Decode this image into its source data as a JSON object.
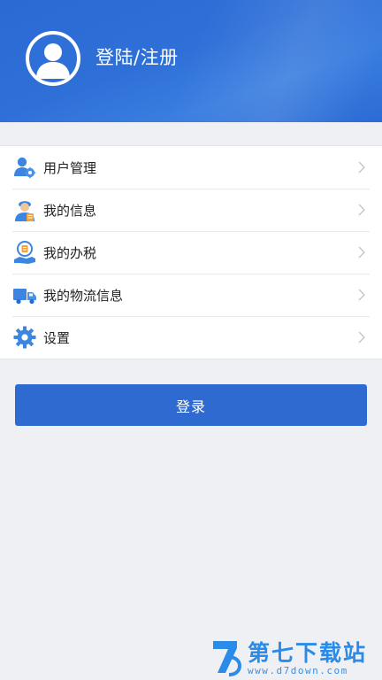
{
  "header": {
    "title": "登陆/注册",
    "avatar_icon": "user-avatar-icon",
    "background_color": "#2f70d8"
  },
  "menu": {
    "items": [
      {
        "label": "用户管理",
        "icon": "user-manage-icon"
      },
      {
        "label": "我的信息",
        "icon": "my-info-icon"
      },
      {
        "label": "我的办税",
        "icon": "tax-handling-icon"
      },
      {
        "label": "我的物流信息",
        "icon": "logistics-truck-icon"
      },
      {
        "label": "设置",
        "icon": "settings-gear-icon"
      }
    ],
    "chevron_icon": "chevron-right-icon"
  },
  "login_button": {
    "label": "登录",
    "color": "#2f6ad1"
  },
  "watermark": {
    "title": "第七下载站",
    "url": "www.d7down.com"
  },
  "colors": {
    "page_background": "#eff0f4",
    "icon_blue": "#3c86e2",
    "icon_orange": "#f0a33a"
  }
}
